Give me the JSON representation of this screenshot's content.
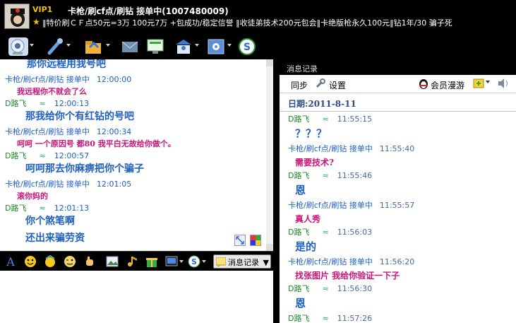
{
  "header": {
    "vip": "VIP1",
    "nickname": "卡枪/刷cf点/刷钻 接单中(1007480009)",
    "signature": "‖特价刷ＣＦ点50元=3万 100元7万 +包成功/稳定信誉 ‖收徒弟技术200元包会‖卡绝版枪永久100元‖钻1年/30 骗子死"
  },
  "history": {
    "messages": [
      {
        "type": "text",
        "text": "那你远程用我号吧",
        "color": "#1e5fbf"
      },
      {
        "type": "meta",
        "name": "卡枪/刷cf点/刷钻 接单中",
        "time": "12:00:00",
        "color": "#1e5fbf"
      },
      {
        "type": "text",
        "text": "我远程你不就会了么",
        "color": "#c8147a"
      },
      {
        "type": "meta",
        "name": "D路飞",
        "wave": "≈",
        "time": "12:00:13",
        "color": "#1a8a2a"
      },
      {
        "type": "text",
        "text": "那我给你个有红钻的号吧",
        "color": "#1e5fbf"
      },
      {
        "type": "meta",
        "name": "卡枪/刷cf点/刷钻 接单中",
        "time": "12:00:34",
        "color": "#1e5fbf"
      },
      {
        "type": "text",
        "text": "呵呵  一个原因号    都80 我平白无故给你做个。",
        "color": "#c8147a"
      },
      {
        "type": "meta",
        "name": "D路飞",
        "wave": "≈",
        "time": "12:00:57",
        "color": "#1a8a2a"
      },
      {
        "type": "text",
        "text": "呵呵那去你麻痹把你个骗子",
        "color": "#1e5fbf"
      },
      {
        "type": "meta",
        "name": "卡枪/刷cf点/刷钻 接单中",
        "time": "12:01:05",
        "color": "#1e5fbf"
      },
      {
        "type": "text",
        "text": "滚你妈的",
        "color": "#c8147a"
      },
      {
        "type": "meta",
        "name": "D路飞",
        "wave": "≈",
        "time": "12:01:13",
        "color": "#1a8a2a"
      },
      {
        "type": "text",
        "text": "你个煞笔啊",
        "color": "#1e5fbf"
      },
      {
        "type": "text",
        "text": "还出来骗劳资",
        "color": "#1e5fbf"
      }
    ]
  },
  "format_bar": {
    "msg_record_label": "消息记录"
  },
  "right_panel": {
    "title": "消息记录",
    "sync_label": "同步",
    "settings_label": "设置",
    "member_label": "会员漫游",
    "date_header": "日期:2011-8-11",
    "entries": [
      {
        "type": "meta",
        "name": "D路飞",
        "wave": "≈",
        "time": "11:55:15",
        "color": "#1a8a2a"
      },
      {
        "type": "text",
        "text": "？？？",
        "color": "#1e5fbf"
      },
      {
        "type": "meta",
        "name": "卡枪/刷cf点/刷钻 接单中",
        "time": "11:55:40",
        "color": "#1e5fbf"
      },
      {
        "type": "text",
        "text": "需要技术?",
        "color": "#c8147a"
      },
      {
        "type": "meta",
        "name": "D路飞",
        "wave": "≈",
        "time": "11:55:46",
        "color": "#1a8a2a"
      },
      {
        "type": "text",
        "text": "恩",
        "color": "#1e5fbf"
      },
      {
        "type": "meta",
        "name": "卡枪/刷cf点/刷钻 接单中",
        "time": "11:55:57",
        "color": "#1e5fbf"
      },
      {
        "type": "text",
        "text": "真人秀",
        "color": "#c8147a"
      },
      {
        "type": "meta",
        "name": "D路飞",
        "wave": "≈",
        "time": "11:56:03",
        "color": "#1a8a2a"
      },
      {
        "type": "text",
        "text": "是的",
        "color": "#1e5fbf"
      },
      {
        "type": "meta",
        "name": "卡枪/刷cf点/刷钻 接单中",
        "time": "11:56:20",
        "color": "#1e5fbf"
      },
      {
        "type": "text",
        "text": "找张图片 我给你验证一下子",
        "color": "#c8147a"
      },
      {
        "type": "meta",
        "name": "D路飞",
        "wave": "≈",
        "time": "11:56:30",
        "color": "#1a8a2a"
      },
      {
        "type": "text",
        "text": "恩",
        "color": "#1e5fbf"
      },
      {
        "type": "meta",
        "name": "D路飞",
        "wave": "≈",
        "time": "11:57:26",
        "color": "#1a8a2a"
      }
    ]
  },
  "icons": {
    "toolbar": [
      "webcam-icon",
      "microphone-icon",
      "folder-icon",
      "mail-icon",
      "screen-share-icon",
      "contact-card-icon",
      "settings-icon",
      "sogou-icon"
    ],
    "format": [
      "font-icon",
      "smiley-icon",
      "magic-face-icon",
      "wink-icon",
      "nudge-hand-icon",
      "image-icon",
      "music-icon",
      "gift-icon",
      "screenshot-icon",
      "sogou-small-icon",
      "message-record-icon"
    ]
  }
}
